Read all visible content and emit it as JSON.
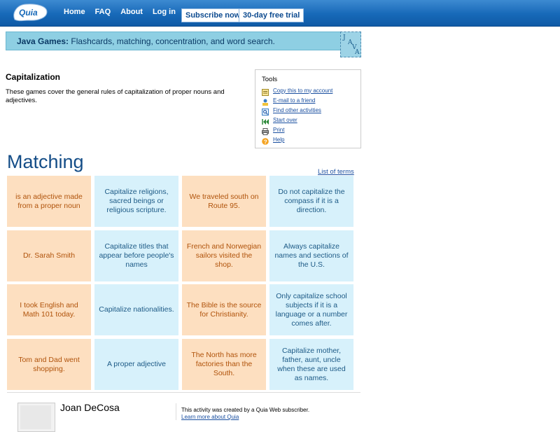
{
  "colors": {
    "nav_bar": "#1769b8",
    "banner": "#8ecfe3",
    "orange_card": "#fddfc0",
    "blue_card": "#d7f1fb",
    "link": "#1a4fa0"
  },
  "logo": {
    "text": "Quia"
  },
  "nav": {
    "items": [
      "Home",
      "FAQ",
      "About",
      "Log in"
    ]
  },
  "buttons": {
    "subscribe": "Subscribe now",
    "trial": "30-day free trial"
  },
  "banner": {
    "label": "Java Games:",
    "text": "Flashcards, matching, concentration, and word search.",
    "icon_letters": [
      "J",
      "A",
      "V",
      "A"
    ]
  },
  "page": {
    "title": "Capitalization",
    "description": "These games cover the general rules of capitalization of proper nouns and adjectives."
  },
  "tools": {
    "title": "Tools",
    "items": [
      {
        "label": "Copy this to my account",
        "icon": "copy-icon"
      },
      {
        "label": "E-mail to a friend",
        "icon": "email-icon"
      },
      {
        "label": "Find other activities",
        "icon": "search-icon"
      },
      {
        "label": "Start over",
        "icon": "rewind-icon"
      },
      {
        "label": "Print",
        "icon": "print-icon"
      },
      {
        "label": "Help",
        "icon": "help-icon"
      }
    ]
  },
  "matching": {
    "heading": "Matching",
    "list_link": "List of terms"
  },
  "cards": [
    "is an adjective made from a proper noun",
    "Capitalize religions, sacred beings or religious scripture.",
    "We traveled south on Route 95.",
    "Do not capitalize the compass if it is a direction.",
    "Dr. Sarah Smith",
    "Capitalize titles that appear before people's names",
    "French and Norwegian sailors visited the shop.",
    "Always capitalize names and sections of the U.S.",
    "I took English and Math 101 today.",
    "Capitalize nationalities.",
    "The Bible is the source for Christianity.",
    "Only capitalize school subjects if it is a language or a number comes after.",
    "Tom and Dad went shopping.",
    "A proper adjective",
    "The North has more factories than the South.",
    "Capitalize mother, father, aunt, uncle when these are used as names."
  ],
  "footer": {
    "author": "Joan DeCosa",
    "created_text": "This activity was created by a Quia Web subscriber.",
    "learn_more": "Learn more about Quia"
  }
}
